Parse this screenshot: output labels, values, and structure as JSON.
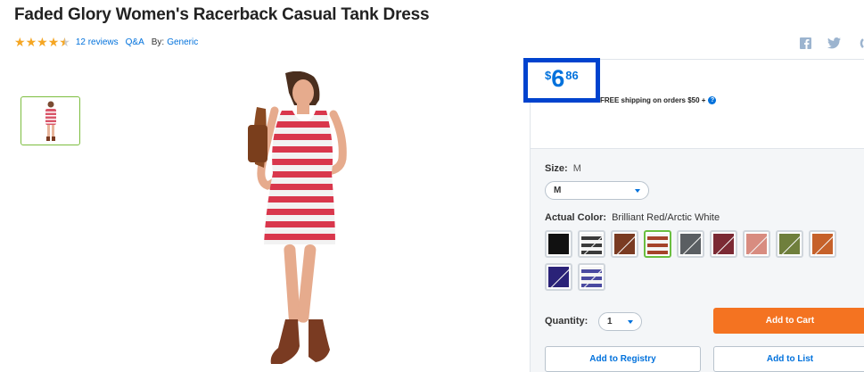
{
  "product": {
    "title": "Faded Glory Women's Racerback Casual Tank Dress",
    "reviews": "12 reviews",
    "qa": "Q&A",
    "by_label": "By:",
    "brand": "Generic"
  },
  "rating": {
    "value": 4.5,
    "max": 5
  },
  "social": [
    "facebook-icon",
    "twitter-icon",
    "more-icon"
  ],
  "price": {
    "currency": "$",
    "dollars": "6",
    "cents": "86"
  },
  "shipping": "FREE shipping on orders $50 +",
  "size": {
    "label": "Size:",
    "value": "M",
    "selected": "M"
  },
  "color": {
    "label": "Actual Color:",
    "value": "Brilliant Red/Arctic White",
    "swatches": [
      {
        "name": "black",
        "color": "#111111",
        "selected": false,
        "oos": false
      },
      {
        "name": "black-white-stripe",
        "color": "#3a3a3a",
        "selected": false,
        "oos": true
      },
      {
        "name": "brown",
        "color": "#7a3b22",
        "selected": false,
        "oos": true
      },
      {
        "name": "red-white-stripe",
        "color": "#a5432a",
        "selected": true,
        "oos": false
      },
      {
        "name": "charcoal",
        "color": "#5a5e62",
        "selected": false,
        "oos": true
      },
      {
        "name": "burgundy",
        "color": "#7b2a34",
        "selected": false,
        "oos": true
      },
      {
        "name": "coral",
        "color": "#d88c80",
        "selected": false,
        "oos": true
      },
      {
        "name": "olive",
        "color": "#6f7f3c",
        "selected": false,
        "oos": true
      },
      {
        "name": "rust",
        "color": "#c6612a",
        "selected": false,
        "oos": true
      },
      {
        "name": "navy",
        "color": "#2a2278",
        "selected": false,
        "oos": true
      },
      {
        "name": "navy-white-stripe",
        "color": "#4a4aa0",
        "selected": false,
        "oos": true
      }
    ]
  },
  "quantity": {
    "label": "Quantity:",
    "value": "1"
  },
  "actions": {
    "add_to_cart": "Add to Cart",
    "add_to_registry": "Add to Registry",
    "add_to_list": "Add to List"
  },
  "colors": {
    "accent": "#0071dc",
    "cart": "#f47321",
    "price_highlight": "#0043ce",
    "star": "#f5a623"
  }
}
